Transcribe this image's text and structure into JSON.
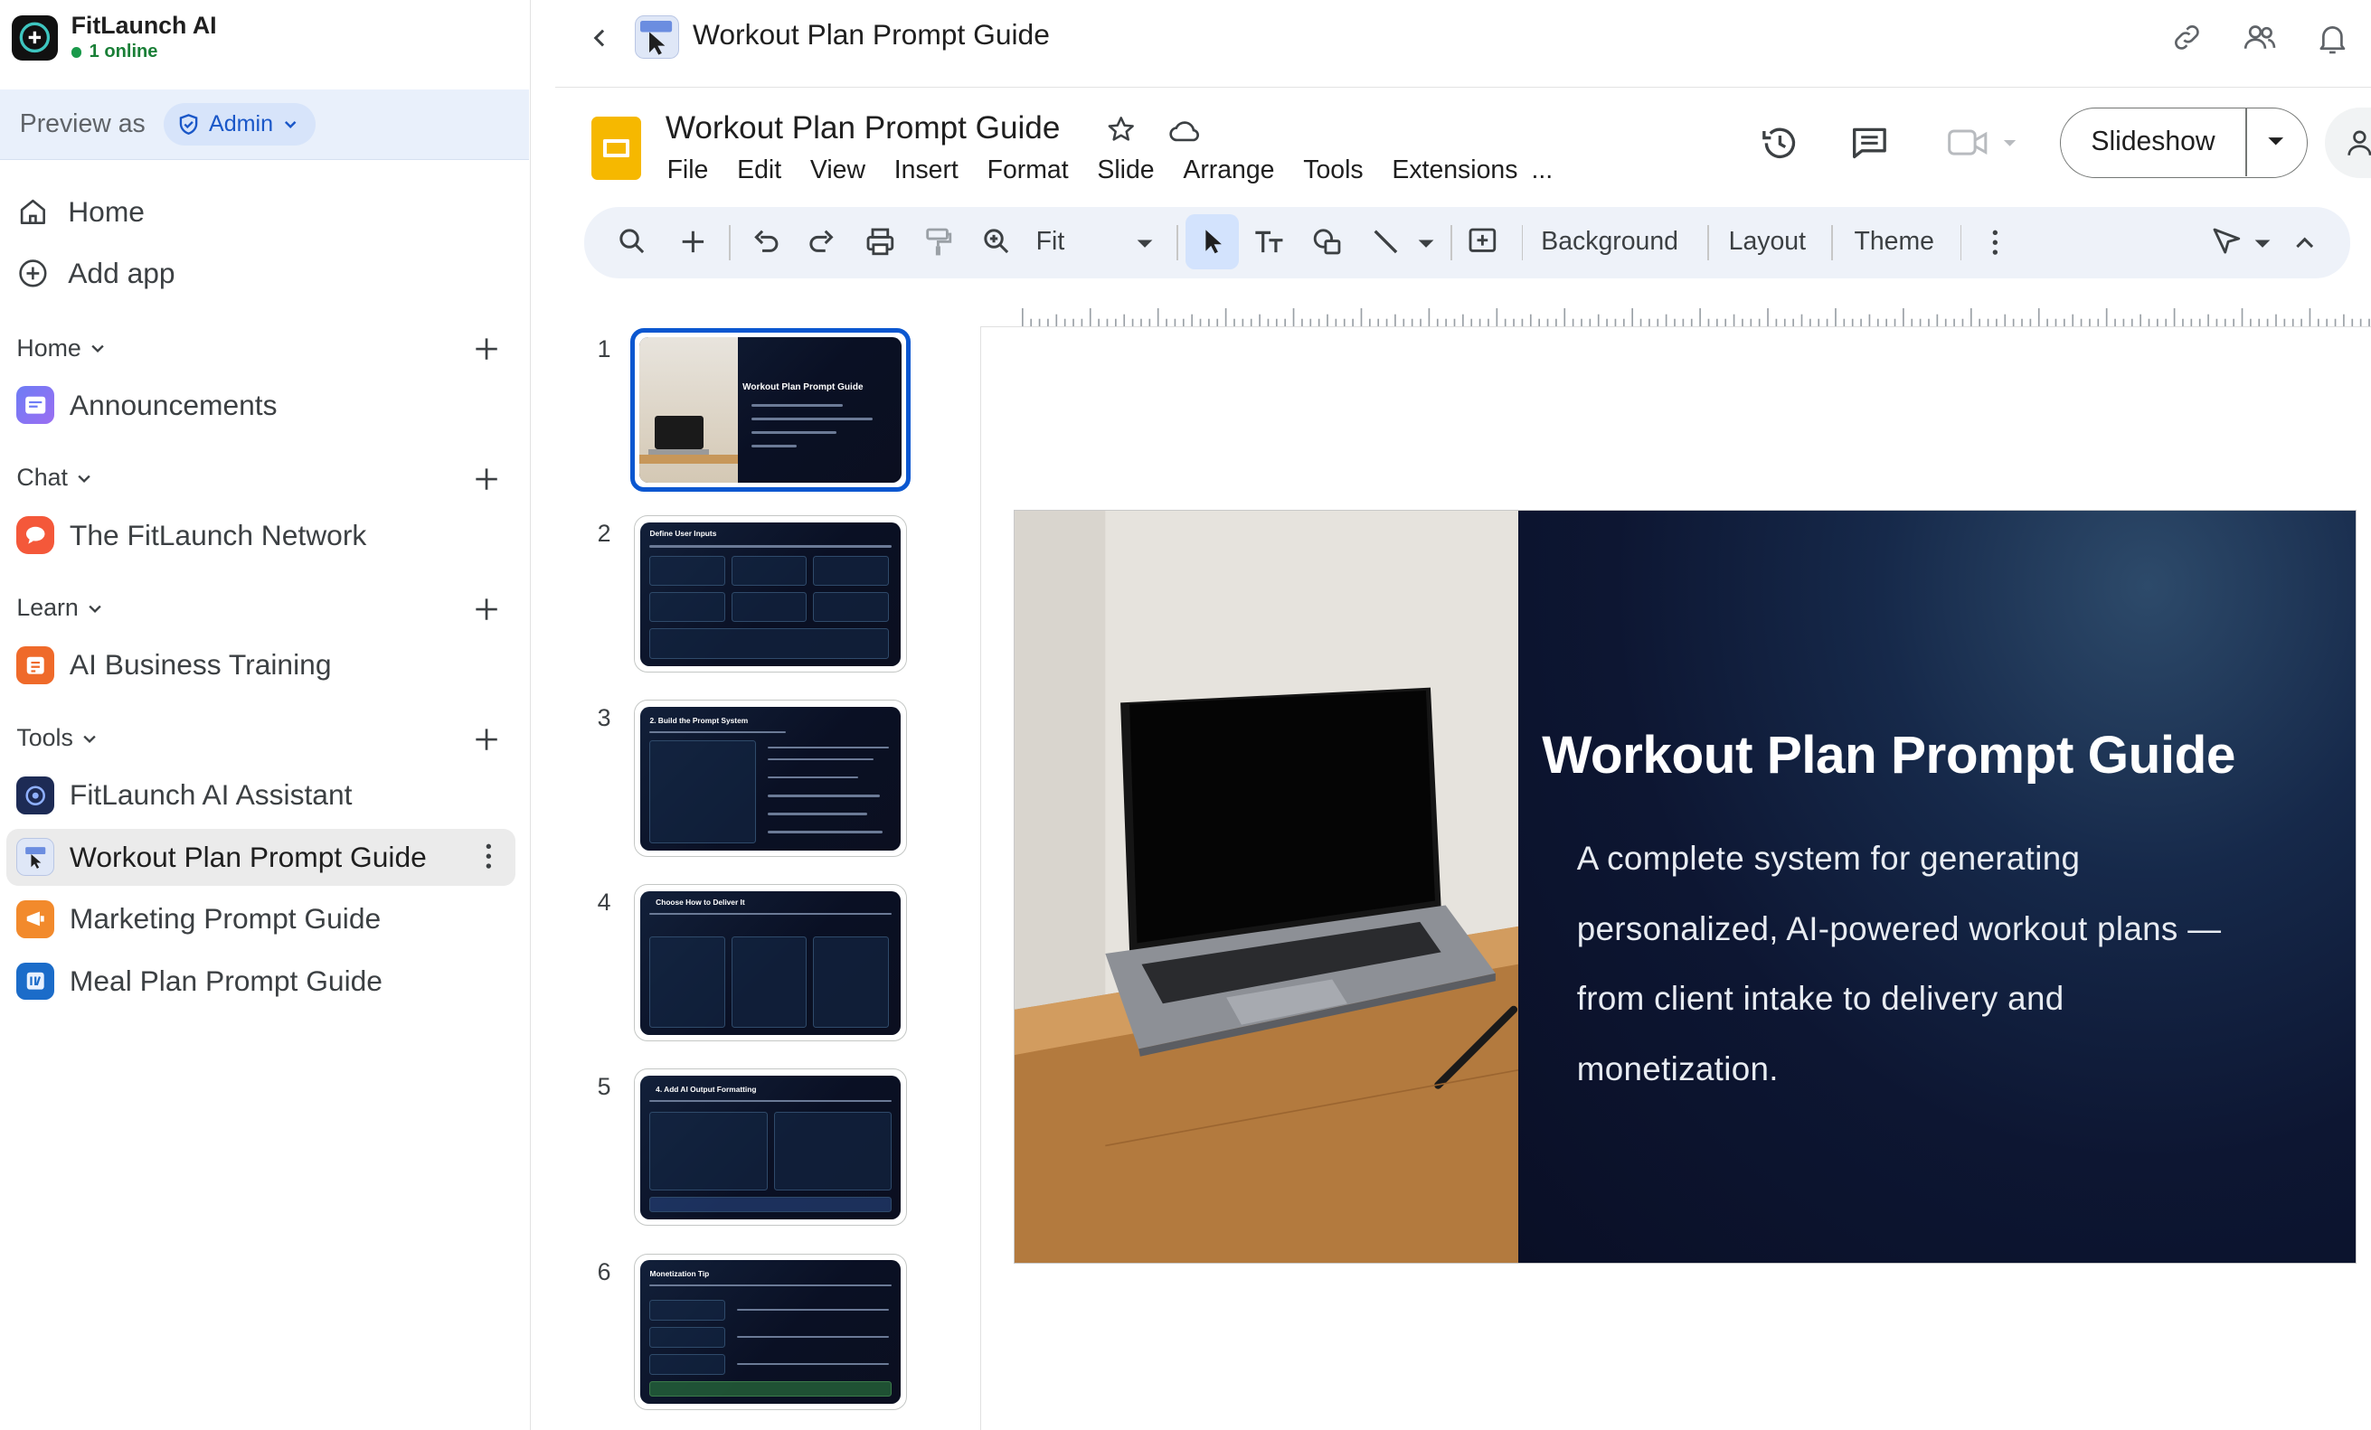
{
  "sidebar": {
    "brand_name": "FitLaunch AI",
    "online_status": "1 online",
    "preview_label": "Preview as",
    "role": "Admin",
    "nav": [
      {
        "label": "Home",
        "icon": "home-icon"
      },
      {
        "label": "Add app",
        "icon": "plus-circle-icon"
      }
    ],
    "sections": [
      {
        "title": "Home",
        "items": [
          {
            "label": "Announcements",
            "icon": "announcements-icon"
          }
        ]
      },
      {
        "title": "Chat",
        "items": [
          {
            "label": "The FitLaunch Network",
            "icon": "chat-bubble-icon"
          }
        ]
      },
      {
        "title": "Learn",
        "items": [
          {
            "label": "AI Business Training",
            "icon": "training-icon"
          }
        ]
      },
      {
        "title": "Tools",
        "items": [
          {
            "label": "FitLaunch AI Assistant",
            "icon": "assistant-icon"
          },
          {
            "label": "Workout Plan Prompt Guide",
            "icon": "slides-cursor-icon",
            "active": true
          },
          {
            "label": "Marketing Prompt Guide",
            "icon": "marketing-icon"
          },
          {
            "label": "Meal Plan Prompt Guide",
            "icon": "meal-plan-icon"
          }
        ]
      }
    ]
  },
  "header": {
    "title": "Workout Plan Prompt Guide"
  },
  "slides_app": {
    "doc_title": "Workout Plan Prompt Guide",
    "menu": [
      "File",
      "Edit",
      "View",
      "Insert",
      "Format",
      "Slide",
      "Arrange",
      "Tools",
      "Extensions",
      "..."
    ],
    "slideshow_label": "Slideshow",
    "toolbar": {
      "zoom": "Fit",
      "background": "Background",
      "layout": "Layout",
      "theme": "Theme"
    },
    "thumbnails": [
      {
        "num": "1",
        "title": "Workout Plan Prompt Guide"
      },
      {
        "num": "2",
        "title": "Define User Inputs"
      },
      {
        "num": "3",
        "title": "2. Build the Prompt System"
      },
      {
        "num": "4",
        "title": "Choose How to Deliver It"
      },
      {
        "num": "5",
        "title": "4. Add AI Output Formatting"
      },
      {
        "num": "6",
        "title": "Monetization Tip"
      }
    ],
    "slide": {
      "title": "Workout Plan Prompt Guide",
      "subtitle_lines": [
        "A complete system for generating",
        "personalized, AI-powered workout plans —",
        "from client intake to delivery and",
        "monetization."
      ]
    }
  },
  "colors": {
    "accent": "#0b57d0",
    "active_bg": "#ebebeb",
    "preview_bg": "#e9f0fb",
    "slide_bg": "#0b1024"
  }
}
